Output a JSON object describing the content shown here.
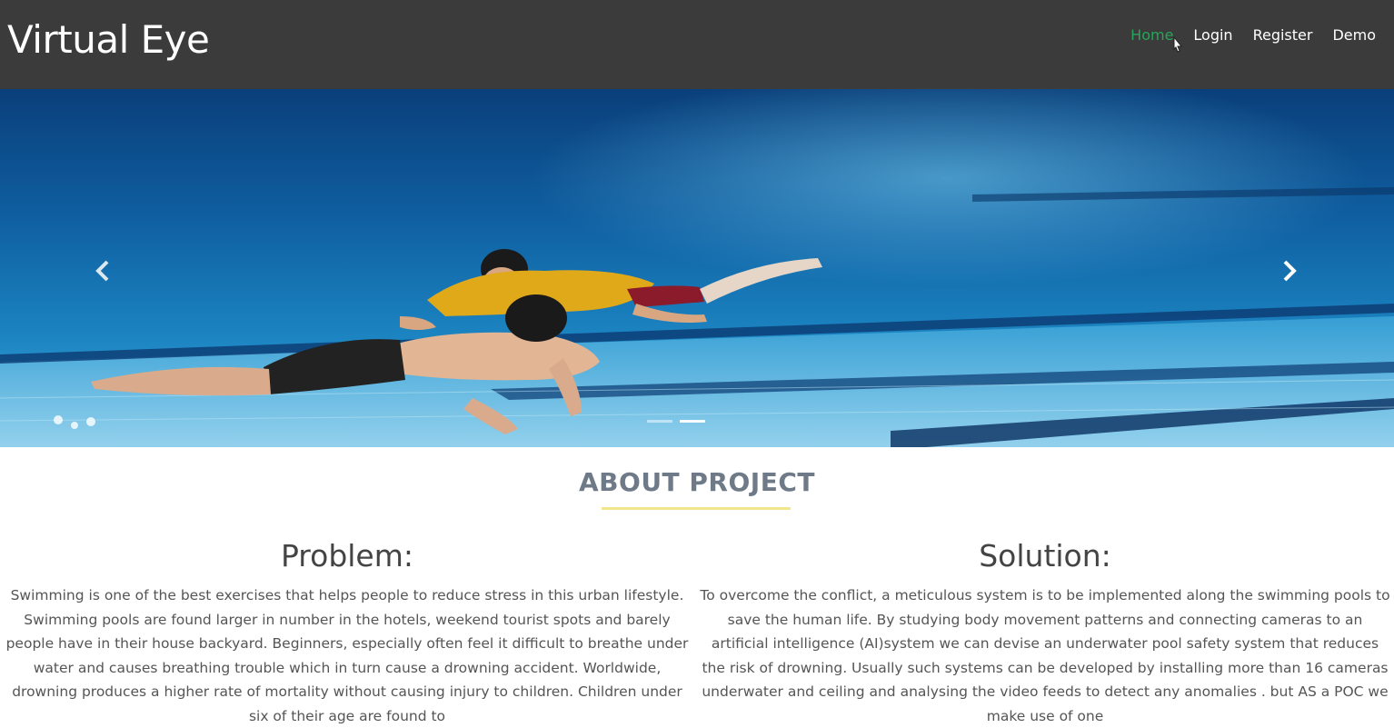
{
  "navbar": {
    "brand": "Virtual Eye",
    "links": [
      {
        "label": "Home",
        "active": true
      },
      {
        "label": "Login",
        "active": false
      },
      {
        "label": "Register",
        "active": false
      },
      {
        "label": "Demo",
        "active": false
      }
    ],
    "active_color": "#26a65b"
  },
  "carousel": {
    "prev_icon": "chevron-left-icon",
    "next_icon": "chevron-right-icon",
    "slide_count": 2,
    "active_slide": 2
  },
  "about": {
    "title": "ABOUT PROJECT",
    "underline_color": "#f2e58c",
    "problem": {
      "heading": "Problem:",
      "text": "Swimming is one of the best exercises that helps people to reduce stress in this urban lifestyle. Swimming pools are found larger in number in the hotels, weekend tourist spots and barely people have in their house backyard. Beginners, especially often feel it difficult to breathe under water and causes breathing trouble which in turn cause a drowning accident. Worldwide, drowning produces a higher rate of mortality without causing injury to children. Children under six of their age are found to"
    },
    "solution": {
      "heading": "Solution:",
      "text": "To overcome the conflict, a meticulous system is to be implemented along the swimming pools to save the human life. By studying body movement patterns and connecting cameras to an artificial intelligence (AI)system we can devise an underwater pool safety system that reduces the risk of drowning. Usually such systems can be developed by installing more than 16 cameras underwater and ceiling and analysing the video feeds to detect any anomalies . but AS a POC we make use of one"
    }
  }
}
